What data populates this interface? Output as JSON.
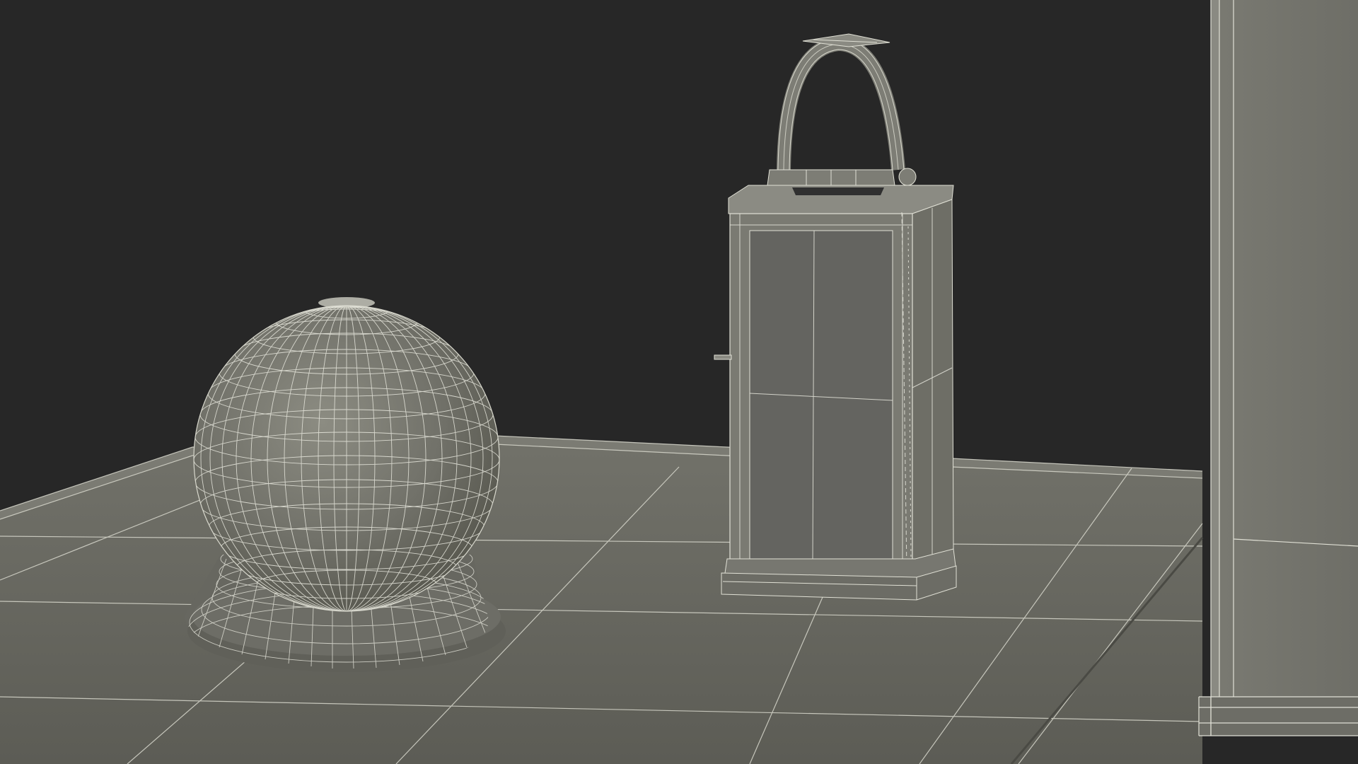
{
  "scene": {
    "render_mode": "wireframe-on-shaded",
    "colors": {
      "background": "#272727",
      "floor": "#676760",
      "floor_far": "#72726a",
      "floor_near": "#5c5c55",
      "model_light": "#8a8a80",
      "model_mid": "#707068",
      "model_dark": "#575751",
      "wire": "#e6e6dc"
    },
    "objects": [
      {
        "name": "snow-globe-sphere"
      },
      {
        "name": "snow-globe-base"
      },
      {
        "name": "lantern"
      },
      {
        "name": "lantern-handle"
      },
      {
        "name": "cabinet-panel"
      },
      {
        "name": "floor-platform"
      }
    ]
  }
}
